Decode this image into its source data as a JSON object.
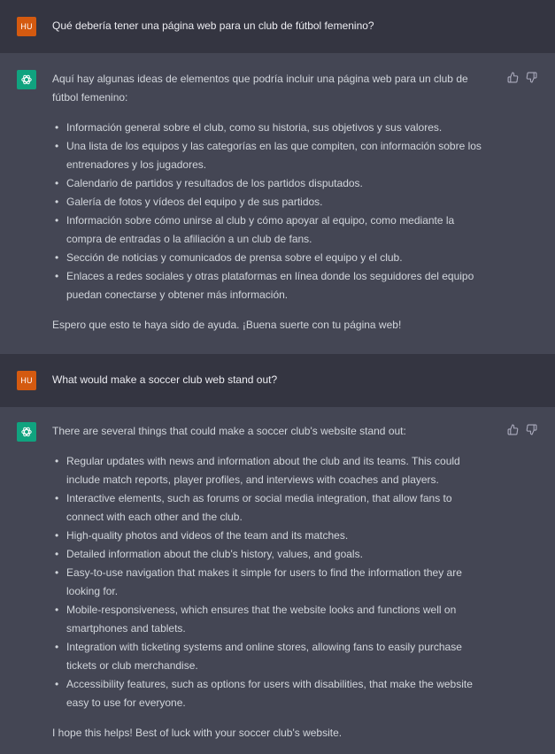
{
  "conversation": {
    "user_avatar_label": "HU",
    "messages": [
      {
        "role": "user",
        "text": "Qué debería tener una página web para un club de fútbol femenino?"
      },
      {
        "role": "assistant",
        "intro": "Aquí hay algunas ideas de elementos que podría incluir una página web para un club de fútbol femenino:",
        "items": [
          "Información general sobre el club, como su historia, sus objetivos y sus valores.",
          "Una lista de los equipos y las categorías en las que compiten, con información sobre los entrenadores y los jugadores.",
          "Calendario de partidos y resultados de los partidos disputados.",
          "Galería de fotos y vídeos del equipo y de sus partidos.",
          "Información sobre cómo unirse al club y cómo apoyar al equipo, como mediante la compra de entradas o la afiliación a un club de fans.",
          "Sección de noticias y comunicados de prensa sobre el equipo y el club.",
          "Enlaces a redes sociales y otras plataformas en línea donde los seguidores del equipo puedan conectarse y obtener más información."
        ],
        "outro": "Espero que esto te haya sido de ayuda. ¡Buena suerte con tu página web!"
      },
      {
        "role": "user",
        "text": "What would make a soccer club web stand out?"
      },
      {
        "role": "assistant",
        "intro": "There are several things that could make a soccer club's website stand out:",
        "items": [
          "Regular updates with news and information about the club and its teams. This could include match reports, player profiles, and interviews with coaches and players.",
          "Interactive elements, such as forums or social media integration, that allow fans to connect with each other and the club.",
          "High-quality photos and videos of the team and its matches.",
          "Detailed information about the club's history, values, and goals.",
          "Easy-to-use navigation that makes it simple for users to find the information they are looking for.",
          "Mobile-responsiveness, which ensures that the website looks and functions well on smartphones and tablets.",
          "Integration with ticketing systems and online stores, allowing fans to easily purchase tickets or club merchandise.",
          "Accessibility features, such as options for users with disabilities, that make the website easy to use for everyone."
        ],
        "outro": "I hope this helps! Best of luck with your soccer club's website."
      }
    ]
  },
  "icons": {
    "assistant_avatar": "openai-logo-icon",
    "like": "thumbs-up-icon",
    "dislike": "thumbs-down-icon"
  },
  "colors": {
    "user_bg": "#343541",
    "assistant_bg": "#444654",
    "user_avatar": "#d45a10",
    "assistant_avatar": "#10a37f"
  }
}
